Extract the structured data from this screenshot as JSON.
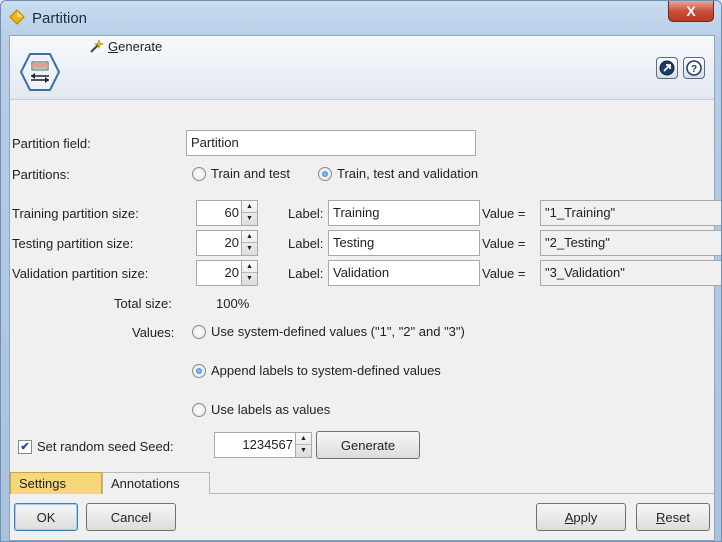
{
  "window": {
    "title": "Partition",
    "close_glyph": "X"
  },
  "toolbar": {
    "generate_label": "Generate",
    "generate_mnemonic": "G",
    "generate_rest": "enerate"
  },
  "form": {
    "partition_field_label": "Partition field:",
    "partition_field_value": "Partition",
    "partitions_label": "Partitions:",
    "partition_options": [
      {
        "label": "Train and test",
        "selected": false
      },
      {
        "label": "Train, test and validation",
        "selected": true
      }
    ],
    "rows": [
      {
        "label": "Training partition size:",
        "size": "60",
        "label_prefix": "Label:",
        "name": "Training",
        "value_prefix": "Value =",
        "value": "\"1_Training\""
      },
      {
        "label": "Testing partition size:",
        "size": "20",
        "label_prefix": "Label:",
        "name": "Testing",
        "value_prefix": "Value =",
        "value": "\"2_Testing\""
      },
      {
        "label": "Validation partition size:",
        "size": "20",
        "label_prefix": "Label:",
        "name": "Validation",
        "value_prefix": "Value =",
        "value": "\"3_Validation\""
      }
    ],
    "total_label": "Total size:",
    "total_value": "100%",
    "values_label": "Values:",
    "value_options": [
      {
        "label": "Use system-defined values (\"1\", \"2\" and \"3\")",
        "selected": false
      },
      {
        "label": "Append labels to system-defined values",
        "selected": true
      },
      {
        "label": "Use labels as values",
        "selected": false
      }
    ],
    "seed": {
      "checked": true,
      "label": "Set random seed Seed:",
      "value": "1234567",
      "generate_button": "Generate"
    }
  },
  "tabs": [
    {
      "label": "Settings",
      "active": true
    },
    {
      "label": "Annotations",
      "active": false
    }
  ],
  "buttons": {
    "ok": "OK",
    "cancel": "Cancel",
    "apply": "Apply",
    "apply_mnemonic": "A",
    "apply_rest": "pply",
    "reset": "Reset",
    "reset_mnemonic": "R",
    "reset_rest": "eset"
  },
  "icons": {
    "title": "diamond-icon",
    "node": "partition-node-icon",
    "generate": "wand-icon",
    "expand": "expand-icon",
    "help": "help-icon"
  },
  "colors": {
    "active_tab": "#f7d77a",
    "title_diamond": "#f2b705",
    "close_button": "#c9503c"
  }
}
